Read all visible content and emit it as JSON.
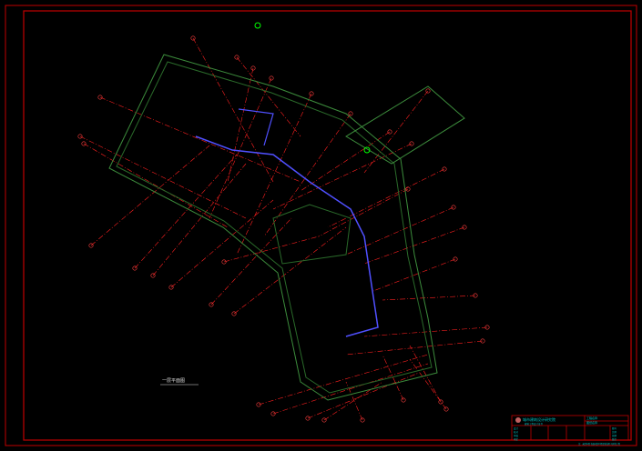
{
  "drawing": {
    "plan_label": "一层平面图",
    "title_block": {
      "company": "城市建筑设计研究院",
      "company_sub": "建筑工程设计证书",
      "project_field": "工程名称",
      "drawing_field": "图纸名称",
      "rows": [
        "设计",
        "校对",
        "审核",
        "审定"
      ],
      "right_rows": [
        "图号",
        "比例",
        "日期",
        "版次"
      ],
      "footer": "注：未经本院书面同意不得复制或用于其他工程"
    },
    "colors": {
      "frame": "#c00000",
      "dimension": "#ff2020",
      "wall": "#3c8c3c",
      "pipe": "#5050ff",
      "text": "#00c8c8"
    }
  }
}
